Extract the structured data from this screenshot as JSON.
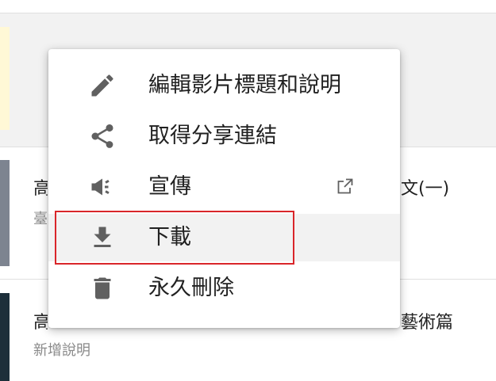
{
  "colors": {
    "highlight_border": "#d9262a",
    "icon": "#606060",
    "hover_bg": "#f2f2f2"
  },
  "menu": {
    "items": [
      {
        "label": "編輯影片標題和說明",
        "icon": "pencil-icon"
      },
      {
        "label": "取得分享連結",
        "icon": "share-icon"
      },
      {
        "label": "宣傳",
        "icon": "megaphone-icon",
        "trailing_icon": "open-external-icon"
      },
      {
        "label": "下載",
        "icon": "download-icon",
        "hovered": true,
        "highlighted": true
      },
      {
        "label": "永久刪除",
        "icon": "trash-icon"
      }
    ]
  },
  "background_list": {
    "row2": {
      "title_left": "高",
      "title_right": "文(一)",
      "subtitle_left": "臺"
    },
    "row3": {
      "title_left": "高",
      "title_right": "藝術篇",
      "subtitle": "新增說明"
    }
  }
}
